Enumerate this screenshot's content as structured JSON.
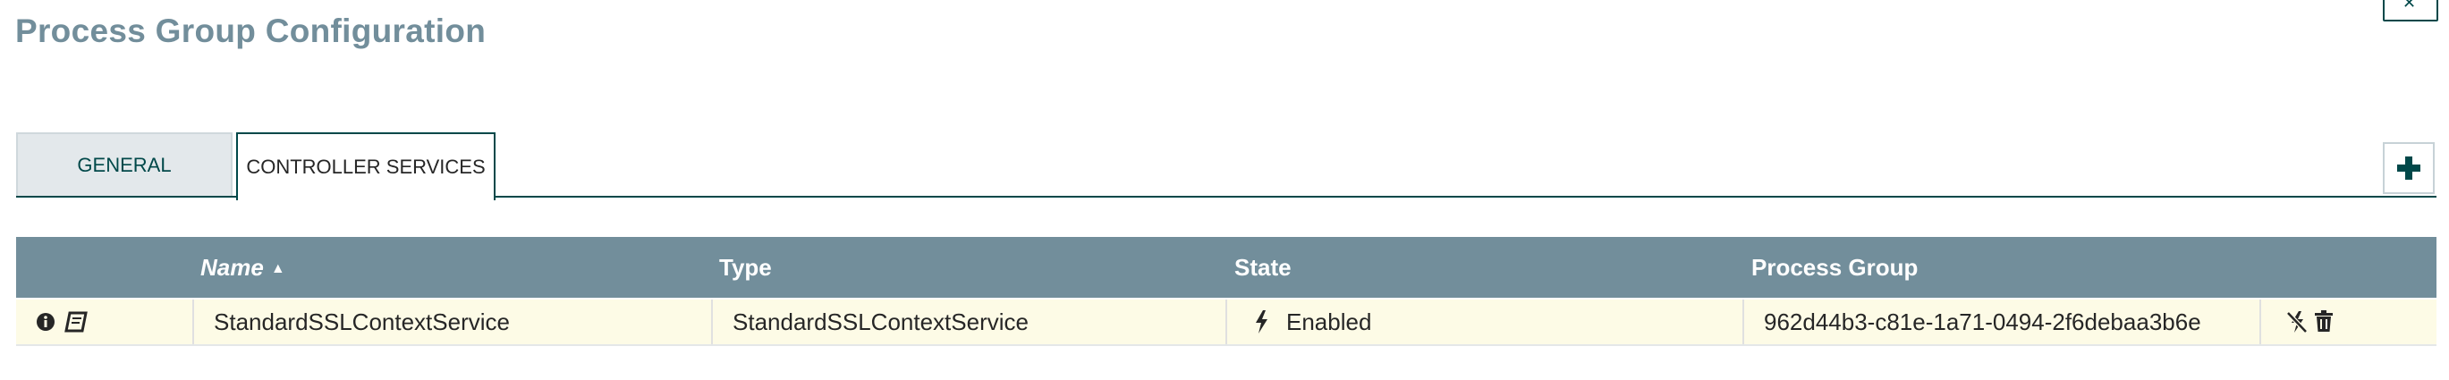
{
  "page": {
    "title": "Process Group Configuration",
    "close_icon": "close-icon"
  },
  "tabs": [
    {
      "label": "GENERAL",
      "selected": false
    },
    {
      "label": "CONTROLLER SERVICES",
      "selected": true
    }
  ],
  "toolbar": {
    "add_icon": "plus-icon"
  },
  "table": {
    "columns": [
      "Name",
      "Type",
      "State",
      "Process Group"
    ],
    "sort_column": "Name",
    "sort_direction": "ascending",
    "rows": [
      {
        "icons": [
          "info-icon",
          "documentation-icon"
        ],
        "name": "StandardSSLContextService",
        "type": "StandardSSLContextService",
        "state_icon": "lightning-icon",
        "state": "Enabled",
        "process_group": "962d44b3-c81e-1a71-0494-2f6debaa3b6e",
        "actions": [
          "disable-icon",
          "delete-icon"
        ]
      }
    ]
  },
  "colors": {
    "title": "#728e9b",
    "header_bg": "#728e9b",
    "accent": "#004849",
    "row_bg": "#fdfbe6"
  }
}
